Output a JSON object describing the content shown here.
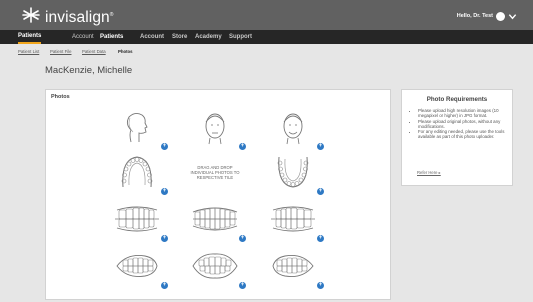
{
  "header": {
    "brand": "invisalign",
    "brand_mark": "®",
    "user_greeting": "Hello, Dr. Test",
    "avatar_icon": "user-avatar-icon",
    "menu_icon": "chevron-down-icon"
  },
  "nav": {
    "items": [
      {
        "label": "Patients",
        "active": true
      },
      {
        "label": "Account",
        "active": false
      },
      {
        "label": "Patients",
        "active": false
      },
      {
        "label": "Account",
        "active": false
      },
      {
        "label": "Store",
        "active": false
      },
      {
        "label": "Academy",
        "active": false
      },
      {
        "label": "Support",
        "active": false
      }
    ]
  },
  "subnav": {
    "items": [
      {
        "label": "Patient List"
      },
      {
        "label": "Patient File"
      },
      {
        "label": "Patient Data"
      },
      {
        "label": "Photos",
        "active": true
      }
    ]
  },
  "patient": {
    "name": "MacKenzie, Michelle"
  },
  "photos": {
    "title": "Photos",
    "drop_text": "DRAG AND DROP INDIVIDUAL PHOTOS TO RESPECTIVE TILE",
    "tiles": [
      "profile-face-icon",
      "frontal-face-icon",
      "smiling-face-icon",
      "upper-arch-icon",
      "drop-zone",
      "lower-arch-icon",
      "right-bite-icon",
      "anterior-bite-icon",
      "left-bite-icon",
      "right-teeth-icon",
      "front-teeth-icon",
      "left-teeth-icon"
    ]
  },
  "requirements": {
    "title": "Photo Requirements",
    "items": [
      "Please upload high resolution images (10 megapixel or higher) in JPG format.",
      "Please upload original photos, without any modifications.",
      "For any editing needed, please use the tools available as part of this photo uploader."
    ],
    "link": "Refer Here"
  },
  "colors": {
    "header_bg": "#616161",
    "nav_bg": "#262626",
    "accent": "#f0a51c",
    "plus_button": "#2e79c4"
  }
}
